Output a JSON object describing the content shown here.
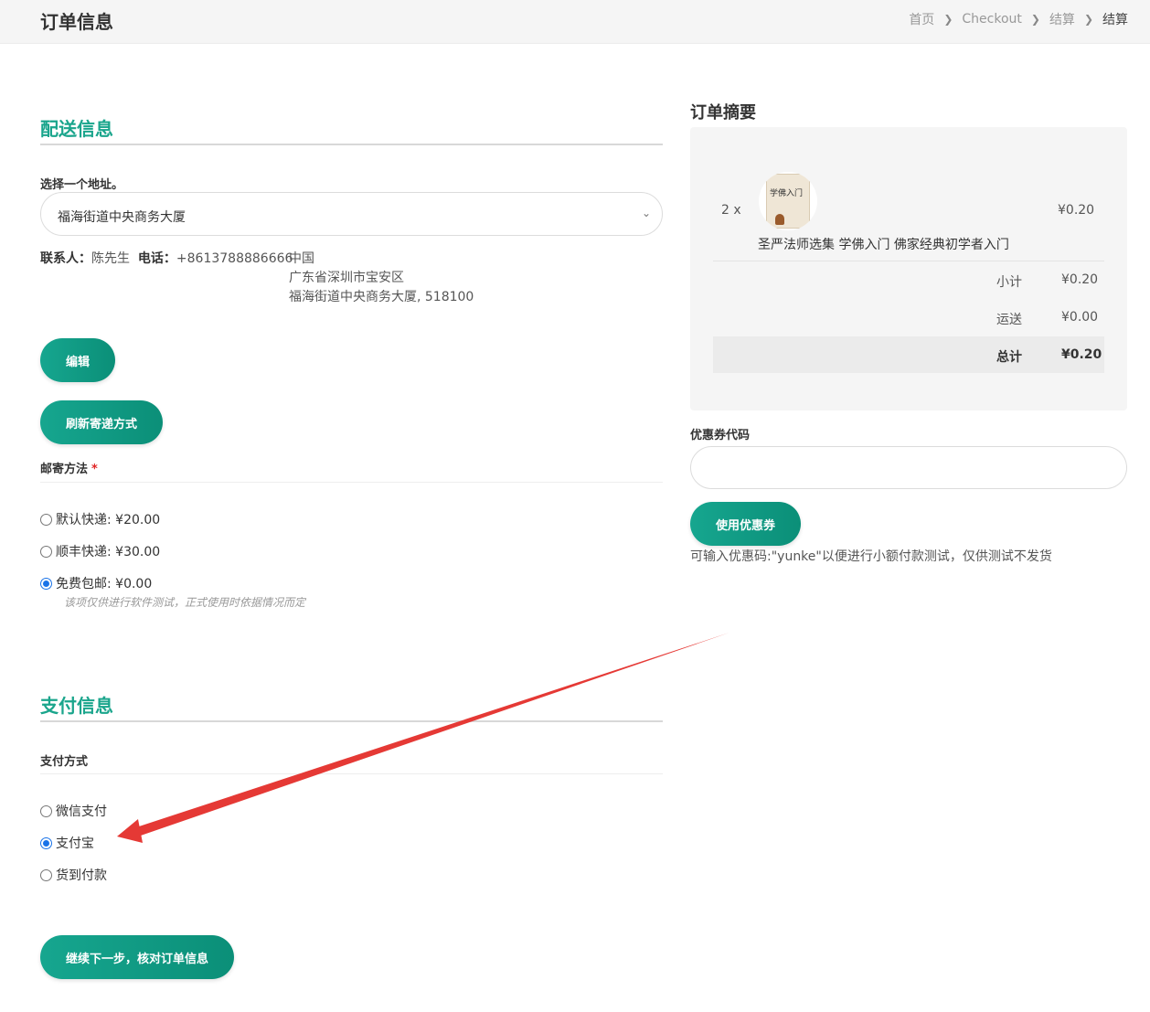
{
  "header": {
    "title": "订单信息",
    "breadcrumb": [
      "首页",
      "Checkout",
      "结算",
      "结算"
    ]
  },
  "shipping": {
    "section_title": "配送信息",
    "address_label": "选择一个地址。",
    "address_selected": "福海街道中央商务大厦",
    "contact_label": "联系人：",
    "contact_name": "陈先生",
    "phone_label": "电话：",
    "phone": "+8613788886666",
    "country": "中国",
    "region": "广东省深圳市宝安区",
    "street": "福海街道中央商务大厦, 518100",
    "edit_button": "编辑",
    "refresh_button": "刷新寄递方式",
    "method_label": "邮寄方法",
    "required_mark": "*",
    "methods": [
      {
        "label": "默认快递: ¥20.00",
        "checked": false
      },
      {
        "label": "顺丰快递: ¥30.00",
        "checked": false
      },
      {
        "label": "免费包邮: ¥0.00",
        "checked": true
      }
    ],
    "free_note": "该项仅供进行软件测试，正式使用时依据情况而定"
  },
  "payment": {
    "section_title": "支付信息",
    "method_label": "支付方式",
    "methods": [
      {
        "label": "微信支付",
        "checked": false
      },
      {
        "label": "支付宝",
        "checked": true
      },
      {
        "label": "货到付款",
        "checked": false
      }
    ],
    "continue_button": "继续下一步，核对订单信息"
  },
  "summary": {
    "title": "订单摘要",
    "item": {
      "qty": "2 x",
      "cover_text": "学佛入门",
      "name": "圣严法师选集 学佛入门 佛家经典初学者入门",
      "price": "¥0.20"
    },
    "subtotal_label": "小计",
    "subtotal": "¥0.20",
    "shipping_label": "运送",
    "shipping": "¥0.00",
    "total_label": "总计",
    "total": "¥0.20"
  },
  "coupon": {
    "label": "优惠券代码",
    "value": "",
    "button": "使用优惠券",
    "tip": "可输入优惠码:\"yunke\"以便进行小额付款测试，仅供测试不发货"
  },
  "colors": {
    "accent": "#1aa58c",
    "button": "#0b8f78",
    "annotation_arrow": "#e53935"
  }
}
